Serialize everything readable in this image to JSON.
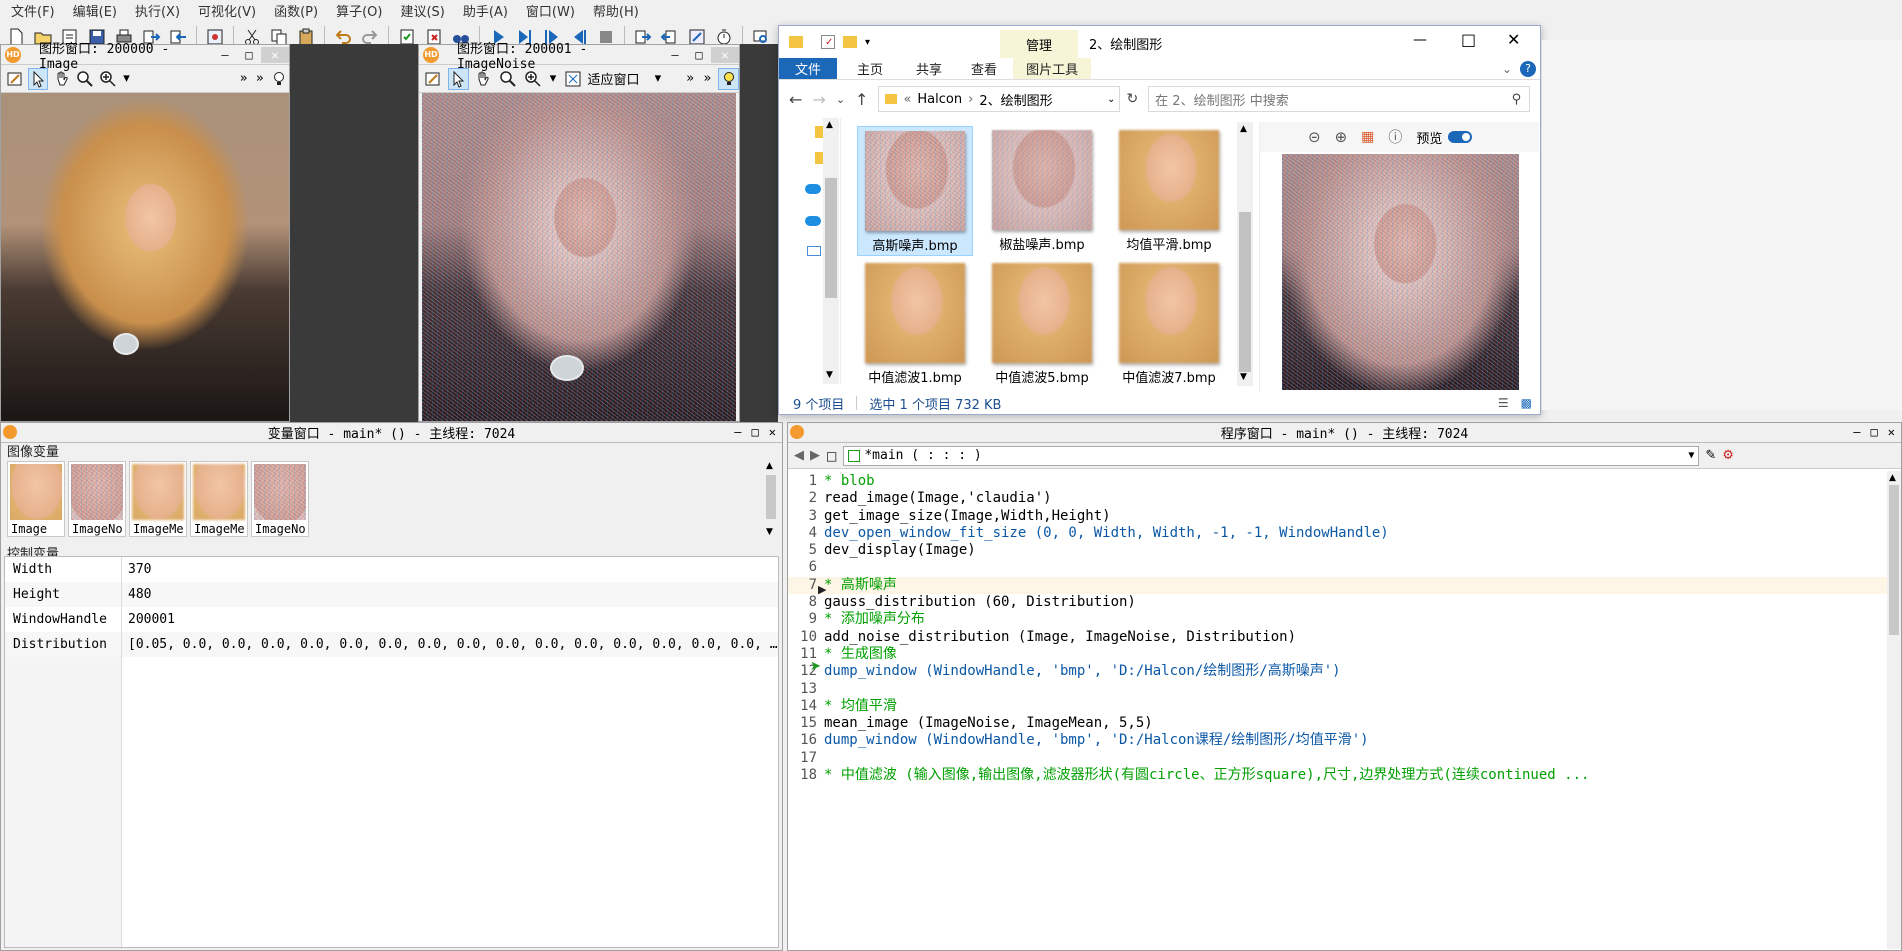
{
  "menu": [
    "文件(F)",
    "编辑(E)",
    "执行(X)",
    "可视化(V)",
    "函数(P)",
    "算子(O)",
    "建议(S)",
    "助手(A)",
    "窗口(W)",
    "帮助(H)"
  ],
  "graphics_windows": [
    {
      "title": "图形窗口: 200000 - Image"
    },
    {
      "title": "图形窗口: 200001 - ImageNoise",
      "fit_label": "适应窗口"
    }
  ],
  "variable_window": {
    "title": "变量窗口 - main* () - 主线程: 7024",
    "image_section": "图像变量",
    "control_section": "控制变量",
    "images": [
      "Image",
      "ImageNo",
      "ImageMe",
      "ImageMe",
      "ImageNo"
    ],
    "controls": [
      {
        "name": "Width",
        "value": "370"
      },
      {
        "name": "Height",
        "value": "480"
      },
      {
        "name": "WindowHandle",
        "value": "200001"
      },
      {
        "name": "Distribution",
        "value": "[0.05, 0.0, 0.0, 0.0, 0.0, 0.0, 0.0, 0.0, 0.0, 0.0, 0.0, 0.0, 0.0, 0.0, 0.0, 0.0, …"
      }
    ]
  },
  "program_window": {
    "title": "程序窗口 - main* () - 主线程: 7024",
    "proc": "*main ( : : : )",
    "lines": [
      {
        "n": "1",
        "text": "* blob",
        "kind": "comment"
      },
      {
        "n": "2",
        "text": "read_image(Image,'claudia')",
        "kind": "plain"
      },
      {
        "n": "3",
        "text": "get_image_size(Image,Width,Height)",
        "kind": "plain"
      },
      {
        "n": "4",
        "text": "dev_open_window_fit_size (0, 0, Width, Width, -1, -1, WindowHandle)",
        "kind": "op"
      },
      {
        "n": "5",
        "text": "dev_display(Image)",
        "kind": "plain"
      },
      {
        "n": "6",
        "text": "",
        "kind": "plain"
      },
      {
        "n": "7",
        "text": "* 高斯噪声",
        "kind": "comment"
      },
      {
        "n": "8",
        "text": "gauss_distribution (60, Distribution)",
        "kind": "plain"
      },
      {
        "n": "9",
        "text": "* 添加噪声分布",
        "kind": "comment"
      },
      {
        "n": "10",
        "text": "add_noise_distribution (Image, ImageNoise, Distribution)",
        "kind": "plain"
      },
      {
        "n": "11",
        "text": "* 生成图像",
        "kind": "comment"
      },
      {
        "n": "12",
        "text": "dump_window (WindowHandle, 'bmp', 'D:/Halcon/绘制图形/高斯噪声')",
        "kind": "op"
      },
      {
        "n": "13",
        "text": "",
        "kind": "plain"
      },
      {
        "n": "14",
        "text": "* 均值平滑",
        "kind": "comment"
      },
      {
        "n": "15",
        "text": "mean_image (ImageNoise, ImageMean, 5,5)",
        "kind": "plain"
      },
      {
        "n": "16",
        "text": "dump_window (WindowHandle, 'bmp', 'D:/Halcon课程/绘制图形/均值平滑')",
        "kind": "op"
      },
      {
        "n": "17",
        "text": "",
        "kind": "plain"
      },
      {
        "n": "18",
        "text": "* 中值滤波 (输入图像,输出图像,滤波器形状(有圆circle、正方形square),尺寸,边界处理方式(连续continued ...",
        "kind": "comment"
      }
    ]
  },
  "explorer": {
    "title": "2、绘制图形",
    "manage_tab": "管理",
    "tabs": [
      "文件",
      "主页",
      "共享",
      "查看",
      "图片工具"
    ],
    "path": [
      "«",
      "Halcon",
      "›",
      "2、绘制图形"
    ],
    "search_placeholder": "在 2、绘制图形 中搜索",
    "files": [
      "高斯噪声.bmp",
      "椒盐噪声.bmp",
      "均值平滑.bmp",
      "中值滤波1.bmp",
      "中值滤波5.bmp",
      "中值滤波7.bmp"
    ],
    "preview_label": "预览",
    "status_count": "9 个项目",
    "status_selected": "选中 1 个项目  732 KB"
  },
  "colors": {
    "file_tab": "#1b67b8",
    "halcon_logo": "#f29a2e",
    "comment": "#00a000",
    "operator": "#0b58a6"
  }
}
